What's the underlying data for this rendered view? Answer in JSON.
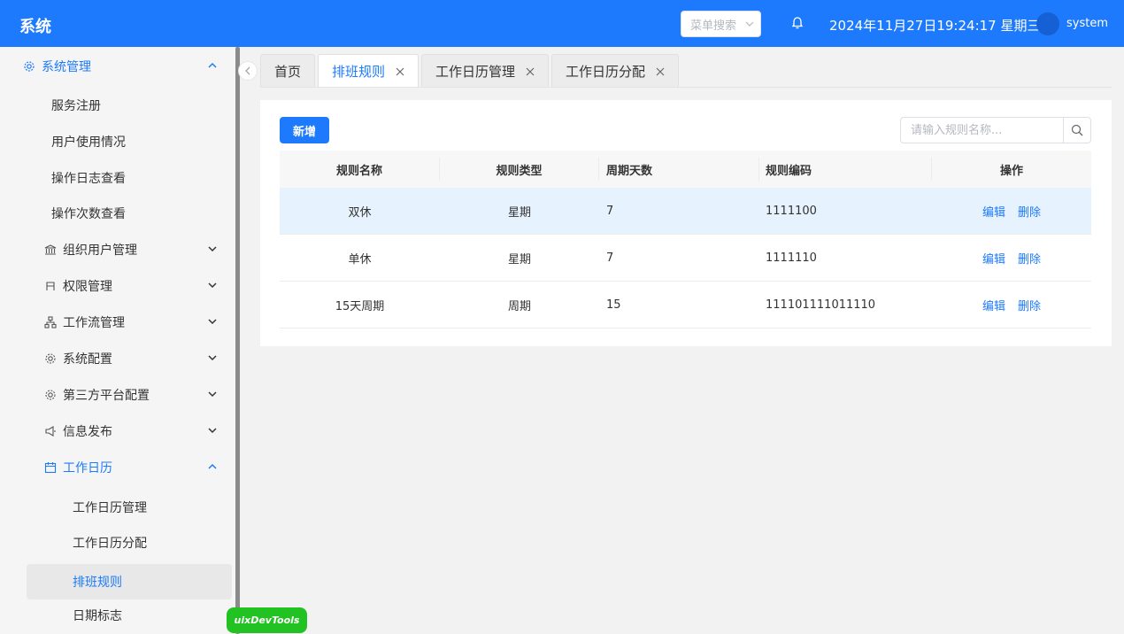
{
  "header": {
    "brand": "系统",
    "menu_search_placeholder": "菜单搜索",
    "datetime": "2024年11月27日19:24:17 星期三",
    "username": "system"
  },
  "sidebar": {
    "group_system": "系统管理",
    "items_system": [
      "服务注册",
      "用户使用情况",
      "操作日志查看",
      "操作次数查看"
    ],
    "groups": [
      {
        "label": "组织用户管理",
        "icon": "bank-icon"
      },
      {
        "label": "权限管理",
        "icon": "user-icon"
      },
      {
        "label": "工作流管理",
        "icon": "flow-icon"
      },
      {
        "label": "系统配置",
        "icon": "gear-icon"
      },
      {
        "label": "第三方平台配置",
        "icon": "gear-icon"
      },
      {
        "label": "信息发布",
        "icon": "megaphone-icon"
      }
    ],
    "group_calendar": "工作日历",
    "items_calendar": [
      "工作日历管理",
      "工作日历分配",
      "排班规则",
      "日期标志"
    ],
    "selected": "排班规则"
  },
  "tabs": [
    {
      "label": "首页",
      "closable": false
    },
    {
      "label": "排班规则",
      "closable": true,
      "active": true
    },
    {
      "label": "工作日历管理",
      "closable": true
    },
    {
      "label": "工作日历分配",
      "closable": true
    }
  ],
  "toolbar": {
    "add_label": "新增",
    "search_placeholder": "请输入规则名称..."
  },
  "table": {
    "headers": [
      "规则名称",
      "规则类型",
      "周期天数",
      "规则编码",
      "操作"
    ],
    "rows": [
      {
        "name": "双休",
        "type": "星期",
        "days": "7",
        "code": "1111100"
      },
      {
        "name": "单休",
        "type": "星期",
        "days": "7",
        "code": "1111110"
      },
      {
        "name": "15天周期",
        "type": "周期",
        "days": "15",
        "code": "111101111011110"
      }
    ],
    "edit_label": "编辑",
    "delete_label": "删除"
  },
  "devtools_label": "uixDevTools",
  "colors": {
    "primary": "#1d7afc",
    "highlight_row": "#e6f2fd"
  }
}
